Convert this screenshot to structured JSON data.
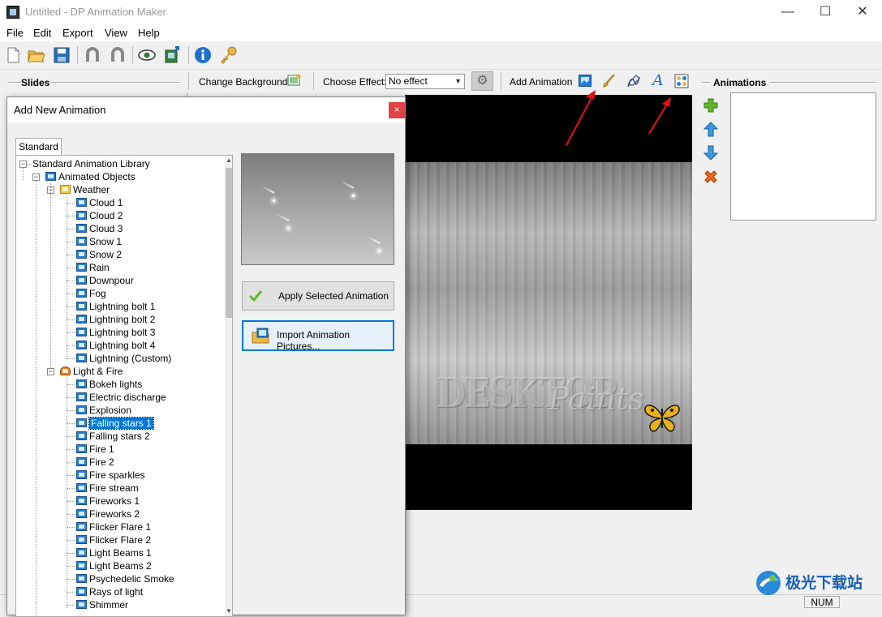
{
  "window": {
    "title": "Untitled - DP Animation Maker",
    "minimize": "—",
    "maximize": "☐",
    "close": "✕"
  },
  "menu": [
    "File",
    "Edit",
    "Export",
    "View",
    "Help"
  ],
  "toolbar": {
    "icons": [
      "new-icon",
      "open-icon",
      "save-icon",
      "undo-icon",
      "redo-icon",
      "preview-icon",
      "export-icon",
      "info-icon",
      "key-icon"
    ]
  },
  "bar2": {
    "slides_label": "Slides",
    "change_background": "Change Background",
    "choose_effect_label": "Choose Effect:",
    "effect_value": "No effect",
    "add_animation_label": "Add Animation",
    "animations_label": "Animations"
  },
  "dialog": {
    "title": "Add New Animation",
    "close": "×",
    "tab": "Standard",
    "apply_button": "Apply Selected Animation",
    "import_button": "Import Animation Pictures...",
    "tree": {
      "root": "Standard Animation Library",
      "group": "Animated Objects",
      "weather": {
        "label": "Weather",
        "items": [
          "Cloud 1",
          "Cloud 2",
          "Cloud 3",
          "Snow 1",
          "Snow 2",
          "Rain",
          "Downpour",
          "Fog",
          "Lightning bolt 1",
          "Lightning bolt 2",
          "Lightning bolt 3",
          "Lightning bolt 4",
          "Lightning (Custom)"
        ]
      },
      "light_fire": {
        "label": "Light & Fire",
        "items": [
          "Bokeh lights",
          "Electric discharge",
          "Explosion",
          "Falling stars 1",
          "Falling stars 2",
          "Fire 1",
          "Fire 2",
          "Fire sparkles",
          "Fire stream",
          "Fireworks 1",
          "Fireworks 2",
          "Flicker Flare 1",
          "Flicker Flare 2",
          "Light Beams 1",
          "Light Beams 2",
          "Psychedelic Smoke",
          "Rays of light",
          "Shimmer"
        ]
      },
      "selected": "Falling stars 1"
    }
  },
  "stage": {
    "logo_text_1": "DESKTOP",
    "logo_text_2": "Paints"
  },
  "status": {
    "num": "NUM"
  },
  "watermark": "极光下载站",
  "colors": {
    "accent": "#0078d7",
    "close_red": "#e04343",
    "arrow_red": "#e81010"
  }
}
